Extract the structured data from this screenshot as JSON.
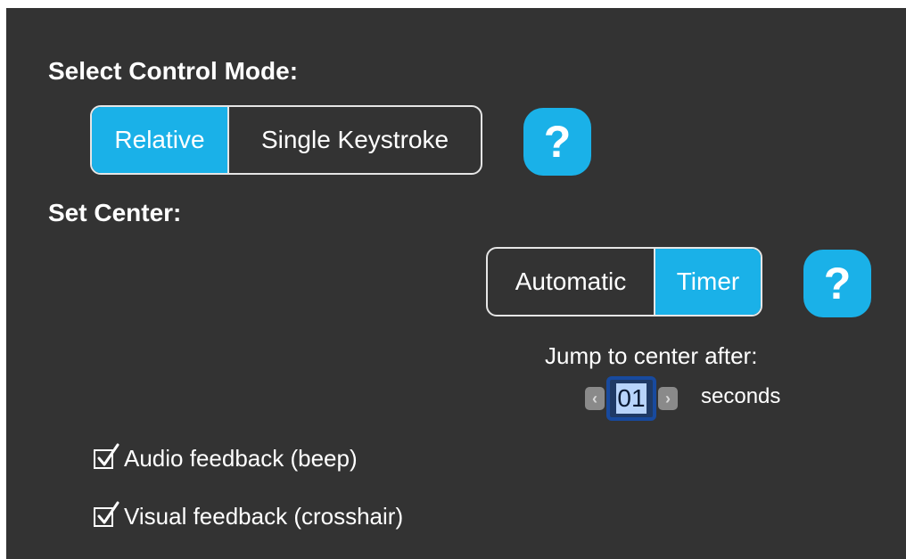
{
  "control_mode": {
    "heading": "Select Control Mode:",
    "options": [
      "Relative",
      "Single Keystroke"
    ],
    "selected": "Relative",
    "help_label": "?"
  },
  "set_center": {
    "heading": "Set Center:",
    "options": [
      "Automatic",
      "Timer"
    ],
    "selected": "Timer",
    "help_label": "?"
  },
  "jump": {
    "label": "Jump to center after:",
    "value": "01",
    "unit": "seconds",
    "decrement_glyph": "‹",
    "increment_glyph": "›"
  },
  "feedback": {
    "audio": {
      "label": "Audio feedback (beep)",
      "checked": true
    },
    "visual": {
      "label": "Visual feedback (crosshair)",
      "checked": true
    }
  },
  "colors": {
    "accent": "#1ab1e8",
    "panel_bg": "#333333",
    "stepper_focus": "#184a9e"
  },
  "icons": [
    "help-icon",
    "chevron-left-icon",
    "chevron-right-icon",
    "checkmark-icon"
  ]
}
